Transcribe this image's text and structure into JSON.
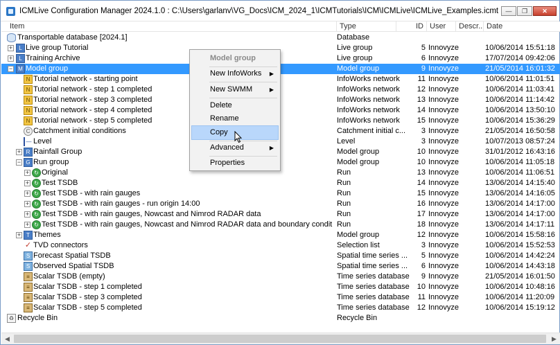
{
  "window": {
    "title": "ICMLive Configuration Manager 2024.1.0 : C:\\Users\\garlanv\\VG_Docs\\ICM_2024_1\\ICMTutorials\\ICM\\ICMLive\\ICMLive_Examples.icmt",
    "minimize_glyph": "—",
    "restore_glyph": "❐",
    "close_glyph": "✕"
  },
  "columns": {
    "item": "Item",
    "type": "Type",
    "id": "ID",
    "user": "User",
    "description": "Descr...",
    "date": "Date"
  },
  "rows": [
    {
      "label": "Transportable database [2024.1]",
      "type": "Database",
      "id": "",
      "user": "",
      "date": "",
      "icon": "database-icon",
      "glyph": ""
    },
    {
      "label": "Live group Tutorial",
      "type": "Live group",
      "id": "5",
      "user": "Innovyze",
      "date": "10/06/2014 15:51:18",
      "icon": "live-group-icon",
      "glyph": "L"
    },
    {
      "label": "Training Archive",
      "type": "Live group",
      "id": "6",
      "user": "Innovyze",
      "date": "17/07/2014 09:42:06",
      "icon": "live-group-icon",
      "glyph": "L"
    },
    {
      "label": "Model group",
      "type": "Model group",
      "id": "9",
      "user": "Innovyze",
      "date": "21/05/2014 16:01:32",
      "icon": "model-group-icon",
      "glyph": "M"
    },
    {
      "label": "Tutorial network - starting point",
      "type": "InfoWorks network",
      "id": "11",
      "user": "Innovyze",
      "date": "10/06/2014 11:01:51",
      "icon": "network-icon",
      "glyph": "N"
    },
    {
      "label": "Tutorial network - step 1 completed",
      "type": "InfoWorks network",
      "id": "12",
      "user": "Innovyze",
      "date": "10/06/2014 11:03:41",
      "icon": "network-icon",
      "glyph": "N"
    },
    {
      "label": "Tutorial network - step 3 completed",
      "type": "InfoWorks network",
      "id": "13",
      "user": "Innovyze",
      "date": "10/06/2014 11:14:42",
      "icon": "network-icon",
      "glyph": "N"
    },
    {
      "label": "Tutorial network - step 4 completed",
      "type": "InfoWorks network",
      "id": "14",
      "user": "Innovyze",
      "date": "10/06/2014 13:50:10",
      "icon": "network-icon",
      "glyph": "N"
    },
    {
      "label": "Tutorial network - step 5 completed",
      "type": "InfoWorks network",
      "id": "15",
      "user": "Innovyze",
      "date": "10/06/2014 15:36:29",
      "icon": "network-icon",
      "glyph": "N"
    },
    {
      "label": "Catchment initial conditions",
      "type": "Catchment initial c...",
      "id": "3",
      "user": "Innovyze",
      "date": "21/05/2014 16:50:58",
      "icon": "catchment-icon",
      "glyph": "C"
    },
    {
      "label": "Level",
      "type": "Level",
      "id": "3",
      "user": "Innovyze",
      "date": "10/07/2013 08:57:24",
      "icon": "level-icon",
      "glyph": "—"
    },
    {
      "label": "Rainfall Group",
      "type": "Model group",
      "id": "10",
      "user": "Innovyze",
      "date": "31/01/2012 16:43:16",
      "icon": "rainfall-group-icon",
      "glyph": "R"
    },
    {
      "label": "Run group",
      "type": "Model group",
      "id": "10",
      "user": "Innovyze",
      "date": "10/06/2014 11:05:18",
      "icon": "run-group-icon",
      "glyph": "G"
    },
    {
      "label": "Original",
      "type": "Run",
      "id": "13",
      "user": "Innovyze",
      "date": "10/06/2014 11:06:51",
      "icon": "run-icon",
      "glyph": "↻"
    },
    {
      "label": "Test TSDB",
      "type": "Run",
      "id": "14",
      "user": "Innovyze",
      "date": "13/06/2014 14:15:40",
      "icon": "run-icon",
      "glyph": "↻"
    },
    {
      "label": "Test TSDB - with rain gauges",
      "type": "Run",
      "id": "15",
      "user": "Innovyze",
      "date": "13/06/2014 14:16:05",
      "icon": "run-icon",
      "glyph": "↻"
    },
    {
      "label": "Test TSDB - with rain gauges - run origin 14:00",
      "type": "Run",
      "id": "16",
      "user": "Innovyze",
      "date": "13/06/2014 14:17:00",
      "icon": "run-icon",
      "glyph": "↻"
    },
    {
      "label": "Test TSDB - with rain gauges, Nowcast and Nimrod RADAR data",
      "type": "Run",
      "id": "17",
      "user": "Innovyze",
      "date": "13/06/2014 14:17:00",
      "icon": "run-icon",
      "glyph": "↻"
    },
    {
      "label": "Test TSDB - with rain gauges, Nowcast and Nimrod RADAR data and boundary conditions at outfall",
      "type": "Run",
      "id": "18",
      "user": "Innovyze",
      "date": "13/06/2014 14:17:11",
      "icon": "run-icon",
      "glyph": "↻"
    },
    {
      "label": "Themes",
      "type": "Model group",
      "id": "12",
      "user": "Innovyze",
      "date": "10/06/2014 15:58:16",
      "icon": "themes-icon",
      "glyph": "T"
    },
    {
      "label": "TVD connectors",
      "type": "Selection list",
      "id": "3",
      "user": "Innovyze",
      "date": "10/06/2014 15:52:53",
      "icon": "selection-list-icon",
      "glyph": "✓"
    },
    {
      "label": "Forecast Spatial TSDB",
      "type": "Spatial time series ...",
      "id": "5",
      "user": "Innovyze",
      "date": "10/06/2014 14:42:24",
      "icon": "spatial-tsdb-icon",
      "glyph": "S"
    },
    {
      "label": "Observed Spatial TSDB",
      "type": "Spatial time series ...",
      "id": "6",
      "user": "Innovyze",
      "date": "10/06/2014 14:43:18",
      "icon": "spatial-tsdb-icon",
      "glyph": "S"
    },
    {
      "label": "Scalar TSDB (empty)",
      "type": "Time series database",
      "id": "9",
      "user": "Innovyze",
      "date": "21/05/2014 16:01:50",
      "icon": "tsdb-icon",
      "glyph": "≡"
    },
    {
      "label": "Scalar TSDB - step 1 completed",
      "type": "Time series database",
      "id": "10",
      "user": "Innovyze",
      "date": "10/06/2014 10:48:16",
      "icon": "tsdb-icon",
      "glyph": "≡"
    },
    {
      "label": "Scalar TSDB - step 3 completed",
      "type": "Time series database",
      "id": "11",
      "user": "Innovyze",
      "date": "10/06/2014 11:20:09",
      "icon": "tsdb-icon",
      "glyph": "≡"
    },
    {
      "label": "Scalar TSDB - step 5 completed",
      "type": "Time series database",
      "id": "12",
      "user": "Innovyze",
      "date": "10/06/2014 15:19:12",
      "icon": "tsdb-icon",
      "glyph": "≡"
    },
    {
      "label": "Recycle Bin",
      "type": "Recycle Bin",
      "id": "",
      "user": "",
      "date": "",
      "icon": "recycle-bin-icon",
      "glyph": "♻"
    }
  ],
  "context_menu": {
    "header": "Model group",
    "items": [
      {
        "label": "New InfoWorks",
        "submenu": true
      },
      {
        "label": "New SWMM",
        "submenu": true
      },
      {
        "label": "Delete",
        "submenu": false
      },
      {
        "label": "Rename",
        "submenu": false
      },
      {
        "label": "Copy",
        "submenu": false
      },
      {
        "label": "Advanced",
        "submenu": true
      },
      {
        "label": "Properties",
        "submenu": false
      }
    ],
    "submenu_arrow": "▶"
  },
  "scrollbar": {
    "left_arrow": "◀",
    "right_arrow": "▶"
  },
  "colors": {
    "selection": "#3399ff",
    "menu_hover": "#b9d7fb"
  }
}
